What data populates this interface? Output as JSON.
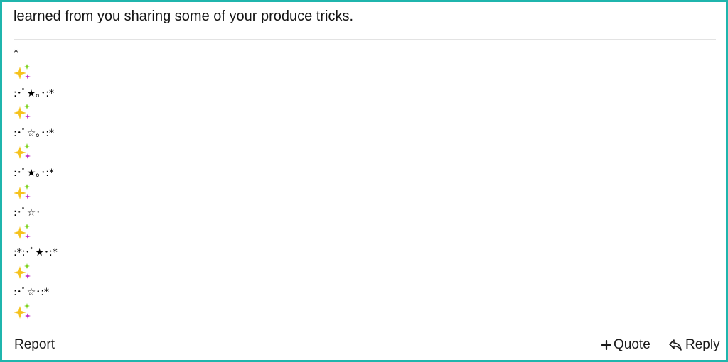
{
  "post": {
    "text": "learned from you sharing some of your produce tricks."
  },
  "signature": {
    "lines": [
      "*",
      ":･ﾟ★｡･:*",
      ":･ﾟ☆｡･:*",
      ":･ﾟ★｡･:*",
      ":･ﾟ☆･",
      ":*:･ﾟ★･:*",
      ":･ﾟ☆･:*"
    ],
    "sparkle_icon": "sparkles-emoji",
    "colors": {
      "sparkle_big": "#f6c21b",
      "sparkle_small_top": "#7ed321",
      "sparkle_small_bottom": "#c030c8"
    }
  },
  "footer": {
    "report_label": "Report",
    "quote_label": "Quote",
    "reply_label": "Reply",
    "quote_icon": "plus-icon",
    "reply_icon": "reply-arrow-icon"
  },
  "colors": {
    "frame_border": "#1fb5ad",
    "text": "#141414",
    "divider": "#e3e3e3"
  }
}
